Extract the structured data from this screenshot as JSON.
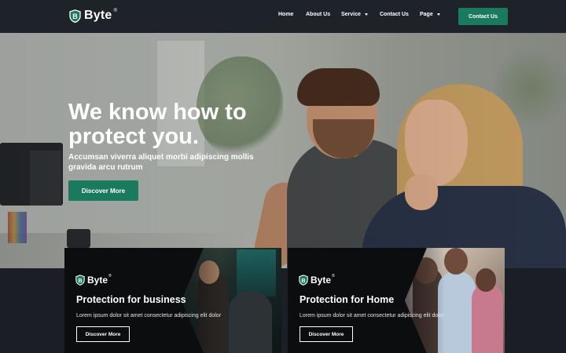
{
  "brand": {
    "name": "Byte",
    "reg": "®"
  },
  "nav": {
    "items": [
      {
        "label": "Home"
      },
      {
        "label": "About Us"
      },
      {
        "label": "Service"
      },
      {
        "label": "Contact Us"
      },
      {
        "label": "Page"
      }
    ],
    "cta": "Contact Us"
  },
  "hero": {
    "title": "We know how to protect you.",
    "subtitle": "Accumsan viverra aliquet morbi adipiscing mollis gravida arcu rutrum",
    "button": "Discover More"
  },
  "cards": [
    {
      "title": "Protection for business",
      "desc": "Lorem ipsum dolor sit amet consectetur adipiscing elit dolor",
      "button": "Discover More"
    },
    {
      "title": "Protection for Home",
      "desc": "Lorem ipsum dolor sit amet consectetur adipiscing elit dolor",
      "button": "Discover More"
    }
  ],
  "colors": {
    "accent": "#1a7a5e",
    "nav_bg": "#1e2229",
    "card_bg": "#0c0d0f"
  }
}
